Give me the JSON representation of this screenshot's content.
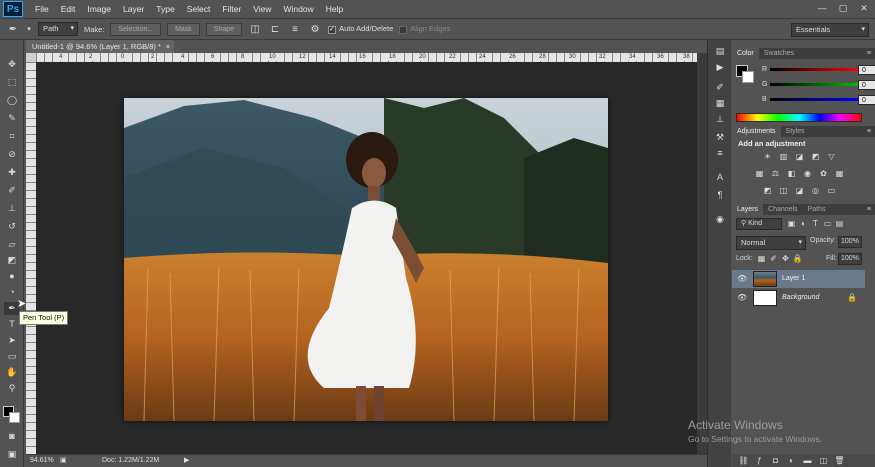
{
  "app": {
    "logo": "Ps"
  },
  "menu": [
    "File",
    "Edit",
    "Image",
    "Layer",
    "Type",
    "Select",
    "Filter",
    "View",
    "Window",
    "Help"
  ],
  "window_controls": [
    "—",
    "▢",
    "✕"
  ],
  "options": {
    "mode": "Path",
    "make_label": "Make:",
    "selection_btn": "Selection...",
    "mask_btn": "Mask",
    "shape_btn": "Shape",
    "auto_add_delete": "Auto Add/Delete",
    "align_edges": "Align Edges",
    "workspace": "Essentials"
  },
  "document": {
    "tab_title": "Untitled-1 @ 94.6% (Layer 1, RGB/8) *",
    "close": "×",
    "ruler_numbers": [
      "4",
      "2",
      "0",
      "2",
      "4",
      "6",
      "8",
      "10",
      "12",
      "14",
      "16",
      "18",
      "20",
      "22",
      "24",
      "26",
      "28",
      "30",
      "32",
      "34",
      "36",
      "38"
    ]
  },
  "status": {
    "zoom": "94.61%",
    "doc": "Doc: 1.22M/1.22M"
  },
  "tooltip": "Pen Tool (P)",
  "color_panel": {
    "tabs": [
      "Color",
      "Swatches"
    ],
    "channels": [
      {
        "label": "R",
        "value": "0",
        "color": "#ff0000"
      },
      {
        "label": "G",
        "value": "0",
        "color": "#00c000"
      },
      {
        "label": "B",
        "value": "0",
        "color": "#0000ff"
      }
    ]
  },
  "adjustments_panel": {
    "tabs": [
      "Adjustments",
      "Styles"
    ],
    "title": "Add an adjustment"
  },
  "layers_panel": {
    "tabs": [
      "Layers",
      "Channels",
      "Paths"
    ],
    "kind": "Kind",
    "blend_mode": "Normal",
    "opacity_label": "Opacity:",
    "opacity": "100%",
    "lock_label": "Lock:",
    "fill_label": "Fill:",
    "fill": "100%",
    "layers": [
      {
        "name": "Layer 1",
        "selected": true
      },
      {
        "name": "Background",
        "selected": false
      }
    ]
  },
  "watermark": {
    "title": "Activate Windows",
    "subtitle": "Go to Settings to activate Windows."
  }
}
